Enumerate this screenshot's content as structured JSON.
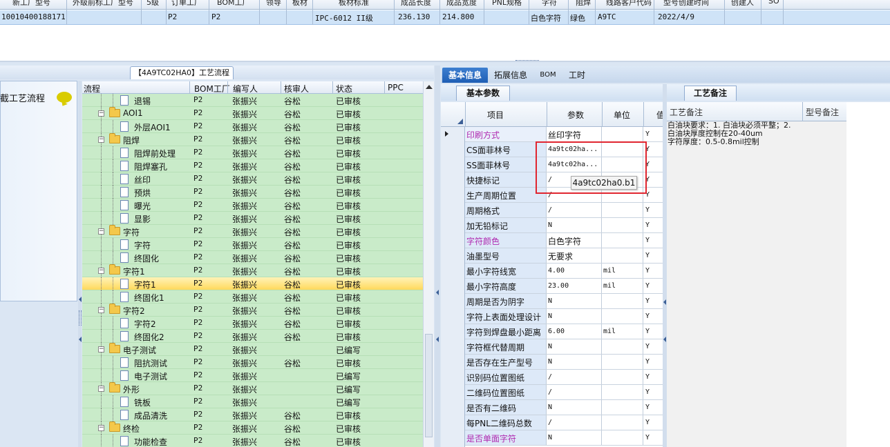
{
  "top_grid": {
    "headers": [
      "新工厂型号",
      "外级前标工厂型号",
      "5级",
      "订单工厂",
      "BOM工厂",
      "领导",
      "板材",
      "板材标准",
      "成品长度",
      "成品宽度",
      "PNL规格",
      "字符",
      "阻焊",
      "线路客户代码",
      "型号创建时间",
      "创建人",
      "SO"
    ],
    "row": {
      "code": "10010400188171",
      "factory1": "P2",
      "factory2": "P2",
      "standard": "IPC-6012 II级",
      "length": "236.130",
      "width": "214.800",
      "char": "白色字符",
      "mask": "绿色",
      "customer": "A9TC",
      "date": "2022/4/9"
    }
  },
  "left_panel": {
    "tab_title": "【4A9TC02HA0】工艺流程",
    "nav_title": "截工艺流程",
    "tree_headers": [
      "流程",
      "BOM工厂",
      "编写人",
      "核审人",
      "状态",
      "PPC"
    ],
    "rows": [
      {
        "level": 1,
        "type": "doc",
        "name": "退锡",
        "bom": "P2",
        "writer": "张振兴",
        "reviewer": "谷松",
        "status": "已审核",
        "selected": false
      },
      {
        "level": 0,
        "type": "folder",
        "name": "AOI1",
        "bom": "P2",
        "writer": "张振兴",
        "reviewer": "谷松",
        "status": "已审核",
        "selected": false
      },
      {
        "level": 1,
        "type": "doc",
        "name": "外层AOI1",
        "bom": "P2",
        "writer": "张振兴",
        "reviewer": "谷松",
        "status": "已审核",
        "selected": false
      },
      {
        "level": 0,
        "type": "folder",
        "name": "阻焊",
        "bom": "P2",
        "writer": "张振兴",
        "reviewer": "谷松",
        "status": "已审核",
        "selected": false
      },
      {
        "level": 1,
        "type": "doc",
        "name": "阻焊前处理",
        "bom": "P2",
        "writer": "张振兴",
        "reviewer": "谷松",
        "status": "已审核",
        "selected": false
      },
      {
        "level": 1,
        "type": "doc",
        "name": "阻焊塞孔",
        "bom": "P2",
        "writer": "张振兴",
        "reviewer": "谷松",
        "status": "已审核",
        "selected": false
      },
      {
        "level": 1,
        "type": "doc",
        "name": "丝印",
        "bom": "P2",
        "writer": "张振兴",
        "reviewer": "谷松",
        "status": "已审核",
        "selected": false
      },
      {
        "level": 1,
        "type": "doc",
        "name": "预烘",
        "bom": "P2",
        "writer": "张振兴",
        "reviewer": "谷松",
        "status": "已审核",
        "selected": false
      },
      {
        "level": 1,
        "type": "doc",
        "name": "曝光",
        "bom": "P2",
        "writer": "张振兴",
        "reviewer": "谷松",
        "status": "已审核",
        "selected": false
      },
      {
        "level": 1,
        "type": "doc",
        "name": "显影",
        "bom": "P2",
        "writer": "张振兴",
        "reviewer": "谷松",
        "status": "已审核",
        "selected": false
      },
      {
        "level": 0,
        "type": "folder",
        "name": "字符",
        "bom": "P2",
        "writer": "张振兴",
        "reviewer": "谷松",
        "status": "已审核",
        "selected": false
      },
      {
        "level": 1,
        "type": "doc",
        "name": "字符",
        "bom": "P2",
        "writer": "张振兴",
        "reviewer": "谷松",
        "status": "已审核",
        "selected": false
      },
      {
        "level": 1,
        "type": "doc",
        "name": "终固化",
        "bom": "P2",
        "writer": "张振兴",
        "reviewer": "谷松",
        "status": "已审核",
        "selected": false
      },
      {
        "level": 0,
        "type": "folder",
        "name": "字符1",
        "bom": "P2",
        "writer": "张振兴",
        "reviewer": "谷松",
        "status": "已审核",
        "selected": false
      },
      {
        "level": 1,
        "type": "doc",
        "name": "字符1",
        "bom": "P2",
        "writer": "张振兴",
        "reviewer": "谷松",
        "status": "已审核",
        "selected": true
      },
      {
        "level": 1,
        "type": "doc",
        "name": "终固化1",
        "bom": "P2",
        "writer": "张振兴",
        "reviewer": "谷松",
        "status": "已审核",
        "selected": false
      },
      {
        "level": 0,
        "type": "folder",
        "name": "字符2",
        "bom": "P2",
        "writer": "张振兴",
        "reviewer": "谷松",
        "status": "已审核",
        "selected": false
      },
      {
        "level": 1,
        "type": "doc",
        "name": "字符2",
        "bom": "P2",
        "writer": "张振兴",
        "reviewer": "谷松",
        "status": "已审核",
        "selected": false
      },
      {
        "level": 1,
        "type": "doc",
        "name": "终固化2",
        "bom": "P2",
        "writer": "张振兴",
        "reviewer": "谷松",
        "status": "已审核",
        "selected": false
      },
      {
        "level": 0,
        "type": "folder",
        "name": "电子测试",
        "bom": "P2",
        "writer": "张振兴",
        "reviewer": "",
        "status": "已编写",
        "selected": false
      },
      {
        "level": 1,
        "type": "doc",
        "name": "阻抗测试",
        "bom": "P2",
        "writer": "张振兴",
        "reviewer": "谷松",
        "status": "已审核",
        "selected": false
      },
      {
        "level": 1,
        "type": "doc",
        "name": "电子测试",
        "bom": "P2",
        "writer": "张振兴",
        "reviewer": "",
        "status": "已编写",
        "selected": false
      },
      {
        "level": 0,
        "type": "folder",
        "name": "外形",
        "bom": "P2",
        "writer": "张振兴",
        "reviewer": "",
        "status": "已编写",
        "selected": false
      },
      {
        "level": 1,
        "type": "doc",
        "name": "铣板",
        "bom": "P2",
        "writer": "张振兴",
        "reviewer": "",
        "status": "已编写",
        "selected": false
      },
      {
        "level": 1,
        "type": "doc",
        "name": "成品清洗",
        "bom": "P2",
        "writer": "张振兴",
        "reviewer": "谷松",
        "status": "已审核",
        "selected": false
      },
      {
        "level": 0,
        "type": "folder",
        "name": "终检",
        "bom": "P2",
        "writer": "张振兴",
        "reviewer": "谷松",
        "status": "已审核",
        "selected": false
      },
      {
        "level": 1,
        "type": "doc",
        "name": "功能检查",
        "bom": "P2",
        "writer": "张振兴",
        "reviewer": "谷松",
        "status": "已审核",
        "selected": false
      }
    ]
  },
  "right_tabs": [
    "基本信息",
    "拓展信息",
    "BOM",
    "工时"
  ],
  "base_panel": {
    "tab": "基本参数",
    "headers": [
      "项目",
      "参数",
      "单位",
      "值"
    ],
    "rows": [
      {
        "item": "印刷方式",
        "value": "丝印字符",
        "unit": "",
        "flag": "Y",
        "mag": true,
        "cn": true
      },
      {
        "item": "CS面菲林号",
        "value": "4a9tc02ha...",
        "unit": "",
        "flag": "Y",
        "mag": false,
        "cn": false
      },
      {
        "item": "SS面菲林号",
        "value": "4a9tc02ha...",
        "unit": "",
        "flag": "Y",
        "mag": false,
        "cn": false
      },
      {
        "item": "快捷标记",
        "value": "/",
        "unit": "",
        "flag": "Y",
        "mag": false,
        "cn": false
      },
      {
        "item": "生产周期位置",
        "value": "/",
        "unit": "",
        "flag": "Y",
        "mag": false,
        "cn": false
      },
      {
        "item": "周期格式",
        "value": "/",
        "unit": "",
        "flag": "Y",
        "mag": false,
        "cn": false
      },
      {
        "item": "加无铅标记",
        "value": "N",
        "unit": "",
        "flag": "Y",
        "mag": false,
        "cn": false
      },
      {
        "item": "字符颜色",
        "value": "白色字符",
        "unit": "",
        "flag": "Y",
        "mag": true,
        "cn": true
      },
      {
        "item": "油墨型号",
        "value": "无要求",
        "unit": "",
        "flag": "Y",
        "mag": false,
        "cn": true
      },
      {
        "item": "最小字符线宽",
        "value": "4.00",
        "unit": "mil",
        "flag": "Y",
        "mag": false,
        "cn": false
      },
      {
        "item": "最小字符高度",
        "value": "23.00",
        "unit": "mil",
        "flag": "Y",
        "mag": false,
        "cn": false
      },
      {
        "item": "周期是否为阴字",
        "value": "N",
        "unit": "",
        "flag": "Y",
        "mag": false,
        "cn": false
      },
      {
        "item": "字符上表面处理设计",
        "value": "N",
        "unit": "",
        "flag": "Y",
        "mag": false,
        "cn": false
      },
      {
        "item": "字符到焊盘最小距离",
        "value": "6.00",
        "unit": "mil",
        "flag": "Y",
        "mag": false,
        "cn": false
      },
      {
        "item": "字符框代替周期",
        "value": "N",
        "unit": "",
        "flag": "Y",
        "mag": false,
        "cn": false
      },
      {
        "item": "是否存在生产型号",
        "value": "N",
        "unit": "",
        "flag": "Y",
        "mag": false,
        "cn": false
      },
      {
        "item": "识别码位置图纸",
        "value": "/",
        "unit": "",
        "flag": "Y",
        "mag": false,
        "cn": false
      },
      {
        "item": "二维码位置图纸",
        "value": "/",
        "unit": "",
        "flag": "Y",
        "mag": false,
        "cn": false
      },
      {
        "item": "是否有二维码",
        "value": "N",
        "unit": "",
        "flag": "Y",
        "mag": false,
        "cn": false
      },
      {
        "item": "每PNL二维码总数",
        "value": "/",
        "unit": "",
        "flag": "Y",
        "mag": false,
        "cn": false
      },
      {
        "item": "是否单面字符",
        "value": "N",
        "unit": "",
        "flag": "Y",
        "mag": true,
        "cn": false
      }
    ],
    "tooltip": "4a9tc02ha0.b1"
  },
  "notes_panel": {
    "tab": "工艺备注",
    "headers": [
      "工艺备注",
      "型号备注"
    ],
    "lines": [
      "白油块要求：1. 白油块必须平整；2.",
      "白油块厚度控制在20-40um",
      "字符厚度：0.5-0.8mil控制"
    ]
  },
  "colors": {
    "selected_row": "#ffd95c",
    "tree_bg": "#c9ebc9",
    "active_tab": "#1f5fb5",
    "highlight_box": "#e0252f",
    "magenta_text": "#b02ab0"
  }
}
